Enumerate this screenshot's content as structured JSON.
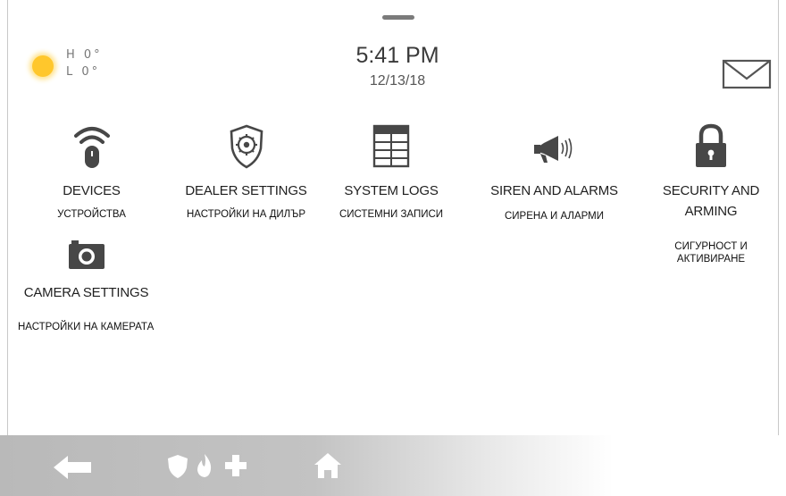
{
  "header": {
    "weather": {
      "icon": "sun-icon",
      "high": "H 0°",
      "low": "L 0°"
    },
    "time": "5:41 PM",
    "date": "12/13/18",
    "mail_icon": "envelope-icon"
  },
  "tiles": [
    {
      "id": "devices",
      "icon": "wifi-device-icon",
      "label": "DEVICES",
      "translation": "УСТРОЙСТВА"
    },
    {
      "id": "dealer-settings",
      "icon": "gear-shield-icon",
      "label": "DEALER SETTINGS",
      "translation": "НАСТРОЙКИ НА ДИЛЪР"
    },
    {
      "id": "system-logs",
      "icon": "table-icon",
      "label": "SYSTEM LOGS",
      "translation": "СИСТЕМНИ ЗАПИСИ"
    },
    {
      "id": "siren-and-alarms",
      "icon": "megaphone-icon",
      "label": "SIREN AND ALARMS",
      "translation": "СИРЕНА И АЛАРМИ"
    },
    {
      "id": "security-and-arming",
      "icon": "padlock-icon",
      "label_line1": "SECURITY AND",
      "label_line2": "ARMING",
      "translation_line1": "СИГУРНОСТ И",
      "translation_line2": "АКТИВИРАНЕ"
    },
    {
      "id": "camera-settings",
      "icon": "camera-icon",
      "label": "CAMERA SETTINGS",
      "translation": "НАСТРОЙКИ НА КАМЕРАТА"
    }
  ],
  "bottom_bar": {
    "icons": [
      "back-arrow-icon",
      "shield-icon",
      "fire-icon",
      "medical-cross-icon",
      "home-icon"
    ]
  },
  "colors": {
    "sun": "#ffc72c",
    "icon_gray": "#4a4a4a",
    "bottom_bar": "#c0c0c0"
  }
}
